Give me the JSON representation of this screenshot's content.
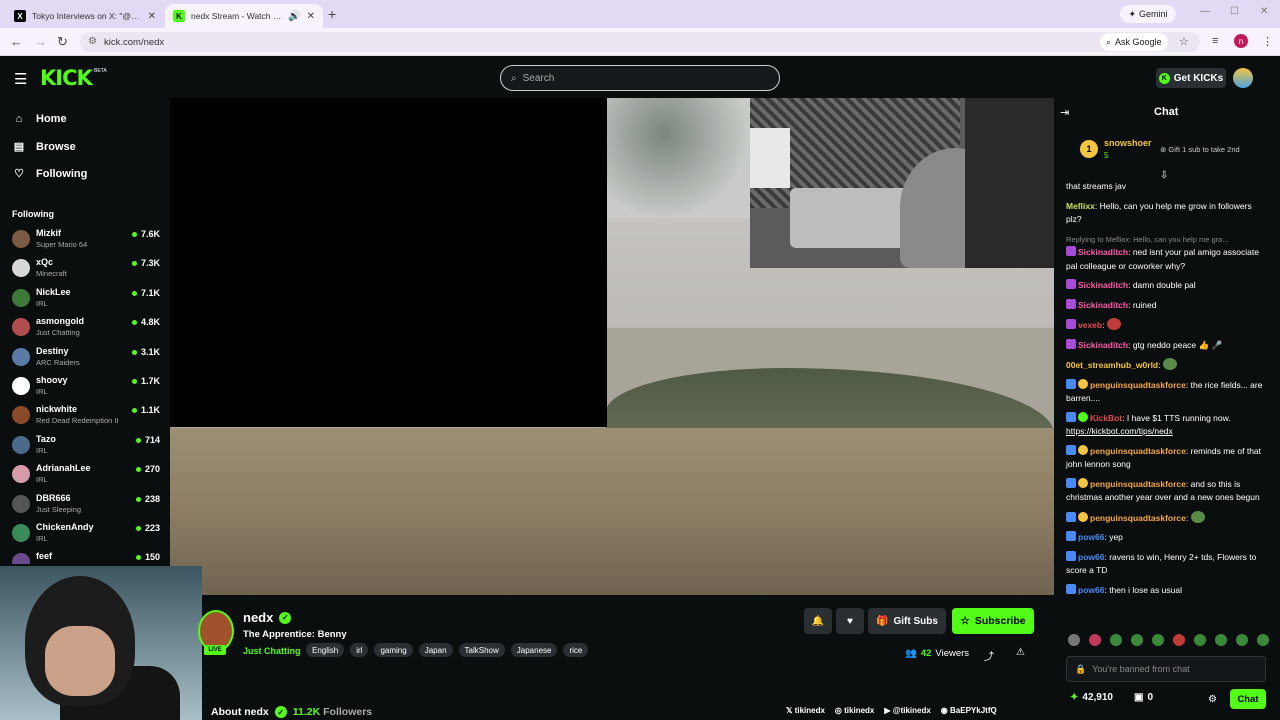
{
  "browser": {
    "tabs": [
      {
        "title": "Tokyo Interviews on X: \"@calli",
        "icon": "x-logo-icon"
      },
      {
        "title": "nedx Stream - Watch Live o",
        "icon": "kick-favicon-icon"
      }
    ],
    "gemini_label": "Gemini",
    "url": "kick.com/nedx",
    "ask_google_label": "Ask Google",
    "profile_initial": "n"
  },
  "header": {
    "logo": "KICK",
    "beta": "BETA",
    "search_placeholder": "Search",
    "get_kicks_label": "Get KICKs"
  },
  "sidebar": {
    "nav": [
      {
        "label": "Home",
        "icon": "home-icon"
      },
      {
        "label": "Browse",
        "icon": "browse-icon"
      },
      {
        "label": "Following",
        "icon": "heart-icon"
      }
    ],
    "following_header": "Following",
    "following": [
      {
        "name": "Mizkif",
        "game": "Super Mario 64",
        "viewers": "7.6K",
        "color": "#7a5c44"
      },
      {
        "name": "xQc",
        "game": "Minecraft",
        "viewers": "7.3K",
        "color": "#d8d8d8"
      },
      {
        "name": "NickLee",
        "game": "IRL",
        "viewers": "7.1K",
        "color": "#3d7a3a"
      },
      {
        "name": "asmongold",
        "game": "Just Chatting",
        "viewers": "4.8K",
        "color": "#b04d4d"
      },
      {
        "name": "Destiny",
        "game": "ARC Raiders",
        "viewers": "3.1K",
        "color": "#5a7ba8"
      },
      {
        "name": "shoovy",
        "game": "IRL",
        "viewers": "1.7K",
        "color": "#ffffff"
      },
      {
        "name": "nickwhite",
        "game": "Red Dead Redemption II",
        "viewers": "1.1K",
        "color": "#8a4a2a"
      },
      {
        "name": "Tazo",
        "game": "IRL",
        "viewers": "714",
        "color": "#4a6a8a"
      },
      {
        "name": "AdrianahLee",
        "game": "IRL",
        "viewers": "270",
        "color": "#d79aa8"
      },
      {
        "name": "DBR666",
        "game": "Just Sleeping",
        "viewers": "238",
        "color": "#555555"
      },
      {
        "name": "ChickenAndy",
        "game": "IRL",
        "viewers": "223",
        "color": "#3a8a5a"
      },
      {
        "name": "feef",
        "game": "",
        "viewers": "150",
        "color": "#6a4a8a"
      }
    ]
  },
  "stream": {
    "channel": "nedx",
    "live_label": "LIVE",
    "title": "The Apprentice: Benny",
    "category": "Just Chatting",
    "tags": [
      "English",
      "irl",
      "gaming",
      "Japan",
      "TalkShow",
      "Japanese",
      "rice"
    ],
    "gift_subs_label": "Gift Subs",
    "subscribe_label": "Subscribe",
    "viewers_count": "42",
    "viewers_label": "Viewers",
    "about_label": "About nedx",
    "followers_count": "11.2K",
    "followers_label": "Followers",
    "socials": [
      {
        "icon": "x-logo-icon",
        "label": "tikinedx"
      },
      {
        "icon": "instagram-icon",
        "label": "tikinedx"
      },
      {
        "icon": "youtube-icon",
        "label": "@tikinedx"
      },
      {
        "icon": "discord-icon",
        "label": "BaEPYkJtfQ"
      }
    ]
  },
  "chat": {
    "header": "Chat",
    "pinned": {
      "rank": "1",
      "user": "snowshoer",
      "count": "5",
      "note": "Gift 1 sub to take 2nd"
    },
    "messages": [
      {
        "user": "",
        "color": "#ffffff",
        "text": "that streams jav"
      },
      {
        "user": "Meflixx",
        "color": "#c6e35a",
        "text": "Hello, can you help me grow in followers plz?"
      },
      {
        "reply": "Replying to Meflixx: Hello, can you help me gro...",
        "user": "Sickinaditch",
        "color": "#ff5aa8",
        "text": "ned isnt your pal amigo associate pal colleague or coworker why?"
      },
      {
        "user": "Sickinaditch",
        "color": "#ff5aa8",
        "text": "damn double pal"
      },
      {
        "user": "Sickinaditch",
        "color": "#ff5aa8",
        "text": "ruined"
      },
      {
        "user": "vexeb",
        "color": "#e34a4a",
        "text": ""
      },
      {
        "user": "Sickinaditch",
        "color": "#ff5aa8",
        "text": "gtg neddo peace 👍 🎤"
      },
      {
        "user": "00et_streamhub_w0rld",
        "color": "#f4c542",
        "text": ""
      },
      {
        "user": "penguinsquadtaskforce",
        "color": "#f4a742",
        "text": "the rice fields... are barren...."
      },
      {
        "user": "KickBot",
        "color": "#e34a4a",
        "text": "I have $1 TTS running now.",
        "link": "https://kickbot.com/tips/nedx"
      },
      {
        "user": "penguinsquadtaskforce",
        "color": "#f4a742",
        "text": "reminds me of that john lennon song"
      },
      {
        "user": "penguinsquadtaskforce",
        "color": "#f4a742",
        "text": "and so this is christmas another year over and a new ones begun"
      },
      {
        "user": "penguinsquadtaskforce",
        "color": "#f4a742",
        "text": ""
      },
      {
        "user": "pow66",
        "color": "#4a8af4",
        "text": "yep"
      },
      {
        "user": "pow66",
        "color": "#4a8af4",
        "text": "ravens to win, Henry 2+ tds, Flowers to score a TD"
      },
      {
        "user": "pow66",
        "color": "#4a8af4",
        "text": "then i lose as usual"
      }
    ],
    "banned_placeholder": "You're banned from chat",
    "kicks_balance": "42,910",
    "other_balance": "0",
    "chat_button": "Chat"
  }
}
